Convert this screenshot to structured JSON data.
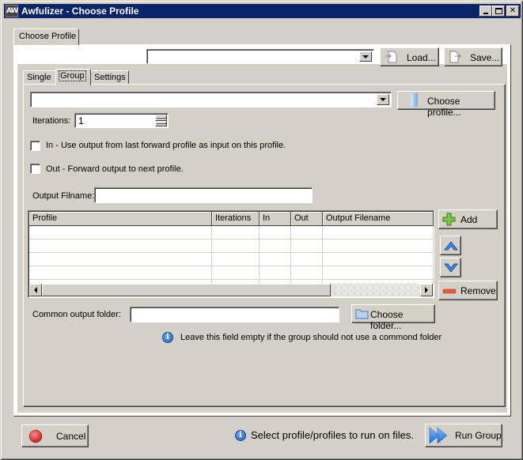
{
  "window": {
    "title": "Awfulizer - Choose Profile",
    "app_icon_text": "AW",
    "controls": [
      "minimize",
      "maximize",
      "close"
    ]
  },
  "outer_tab": {
    "label": "Choose Profile"
  },
  "profile_bar": {
    "profile_combo_value": "",
    "load_label": "Load...",
    "save_label": "Save..."
  },
  "inner_tabs": [
    {
      "label": "Single",
      "active": false
    },
    {
      "label": "Group",
      "active": true
    },
    {
      "label": "Settings",
      "active": false
    }
  ],
  "group": {
    "profile_combo_value": "",
    "choose_profile_label": "Choose profile...",
    "iterations_label": "Iterations:",
    "iterations_value": "1",
    "in_checkbox": {
      "label": "In - Use output from last forward profile as input on this profile.",
      "checked": false
    },
    "out_checkbox": {
      "label": "Out - Forward output to next profile.",
      "checked": false
    },
    "output_filename_label": "Output Filname:",
    "output_filename_value": "",
    "table": {
      "columns": [
        "Profile",
        "Iterations",
        "In",
        "Out",
        "Output Filename"
      ],
      "rows": []
    },
    "add_label": "Add",
    "remove_label": "Remove",
    "common_folder_label": "Common output folder:",
    "common_folder_value": "",
    "choose_folder_label": "Choose folder...",
    "common_folder_hint": "Leave this field empty if the group should not use a commond folder"
  },
  "footer": {
    "cancel_label": "Cancel",
    "status_text": "Select profile/profiles to run on files.",
    "run_label": "Run Group"
  },
  "colors": {
    "titlebar": "#0a246a",
    "face": "#d4d0c8",
    "info_blue": "#1d5fc4",
    "add_green": "#5aa82a",
    "remove_red": "#e04a2a",
    "cancel_red": "#d42a2a"
  }
}
